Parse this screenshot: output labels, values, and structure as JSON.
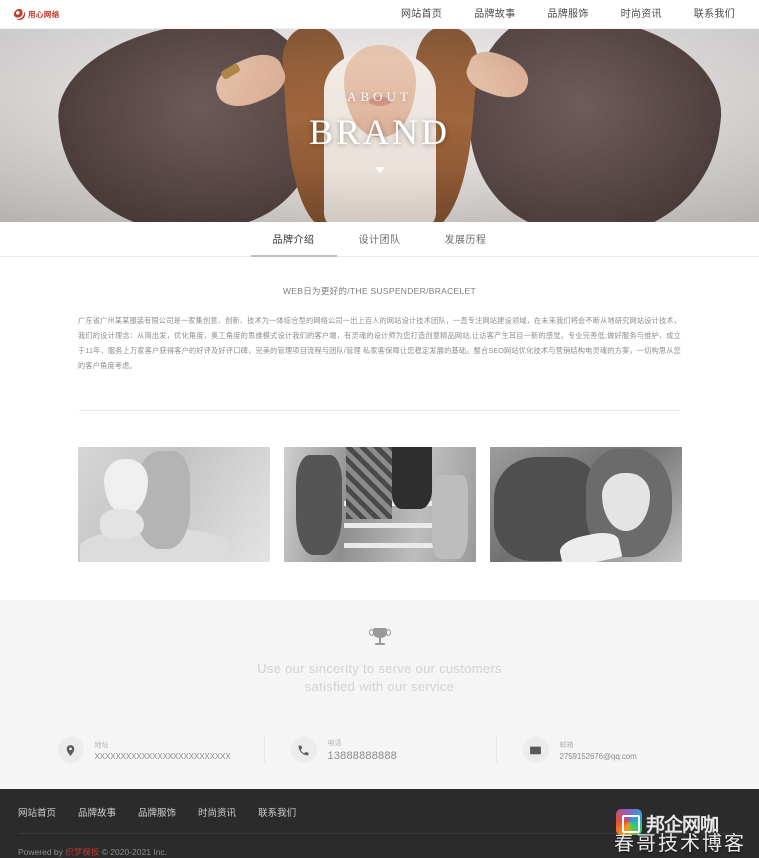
{
  "header": {
    "logo_text": "用心网络",
    "nav": [
      {
        "label": "网站首页"
      },
      {
        "label": "品牌故事"
      },
      {
        "label": "品牌服饰"
      },
      {
        "label": "时尚资讯"
      },
      {
        "label": "联系我们"
      }
    ]
  },
  "hero": {
    "subtitle": "ABOUT",
    "title": "BRAND"
  },
  "tabs": [
    {
      "label": "品牌介绍",
      "active": true
    },
    {
      "label": "设计团队",
      "active": false
    },
    {
      "label": "发展历程",
      "active": false
    }
  ],
  "article": {
    "title": "WEB日为更好的/THE SUSPENDER/BRACELET",
    "body": "广东省广州某某服装有限公司是一家集创意、创新、技术为一体综合型的网络公司一出上百人的网站设计技术团队，一直专注网站建设领域，在未来我们将会不断从地研究网站设计技术，我们的设计理念：从简出发，优化角度，奥工角度的思维模式设计我们的客户端，有灵魂的设计师为您打造创意精品网站,让访客产生耳目一新的感觉。专业完善低,做好服务与维护，成立于11年，服务上万家客户获得客户的好评及好评口碑，完美的管理项目流程与团队/管理 私家客保障让您稳定发展的基础。整合SEO网站优化技术与营销结构电灵魂的方案，一切构思从您的客户角度考虑。"
  },
  "gallery": [
    {
      "alt": "fashion-photo-1"
    },
    {
      "alt": "fashion-photo-2"
    },
    {
      "alt": "fashion-photo-3"
    }
  ],
  "slogan": {
    "icon": "trophy-icon",
    "line1": "Use our sincerity to serve our customers",
    "line2": "satisfied with our service"
  },
  "contacts": [
    {
      "icon": "location-pin-icon",
      "label": "地址",
      "value": "XXXXXXXXXXXXXXXXXXXXXXXXXX"
    },
    {
      "icon": "phone-icon",
      "label": "电话",
      "value": "13888888888"
    },
    {
      "icon": "mail-icon",
      "label": "邮箱",
      "value": "2759152676@qq.com"
    }
  ],
  "footer": {
    "nav": [
      {
        "label": "网站首页"
      },
      {
        "label": "品牌故事"
      },
      {
        "label": "品牌服饰"
      },
      {
        "label": "时尚资讯"
      },
      {
        "label": "联系我们"
      }
    ],
    "powered_prefix": "Powered by",
    "powered_link": "织梦模板",
    "copyright": "© 2020-2021 Inc."
  },
  "watermark": {
    "title": "邦企网咖",
    "subtitle": "春哥技术博客"
  },
  "colors": {
    "brand_red": "#c0392b",
    "footer_bg": "#2b2b2b",
    "band_bg": "#f5f5f5",
    "muted_text": "#8d8d8d"
  }
}
